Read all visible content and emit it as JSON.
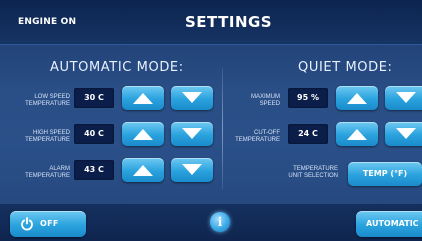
{
  "header": {
    "engine_status": "ENGINE ON",
    "title": "SETTINGS"
  },
  "automatic_mode": {
    "title": "AUTOMATIC MODE:",
    "rows": [
      {
        "label_line1": "LOW SPEED",
        "label_line2": "TEMPERATURE",
        "value": "30 C"
      },
      {
        "label_line1": "HIGH SPEED",
        "label_line2": "TEMPERATURE",
        "value": "40 C"
      },
      {
        "label_line1": "ALARM",
        "label_line2": "TEMPERATURE",
        "value": "43 C"
      }
    ]
  },
  "quiet_mode": {
    "title": "QUIET MODE:",
    "rows": [
      {
        "label_line1": "MAXIMUM",
        "label_line2": "SPEED",
        "value": "95 %"
      },
      {
        "label_line1": "CUT-OFF",
        "label_line2": "TEMPERATURE",
        "value": "24 C"
      }
    ],
    "unit_selection": {
      "label_line1": "TEMPERATURE",
      "label_line2": "UNIT SELECTION",
      "button_label": "TEMP (°F)"
    }
  },
  "footer": {
    "off_label": "OFF",
    "mode_label": "AUTOMATIC"
  },
  "icons": {
    "power": "power-icon",
    "info": "info-icon",
    "up": "arrow-up-icon",
    "down": "arrow-down-icon"
  },
  "colors": {
    "background": "#2a4e86",
    "header": "#0d2450",
    "button": "#2aa2de",
    "value_box": "#0b1e4a"
  }
}
